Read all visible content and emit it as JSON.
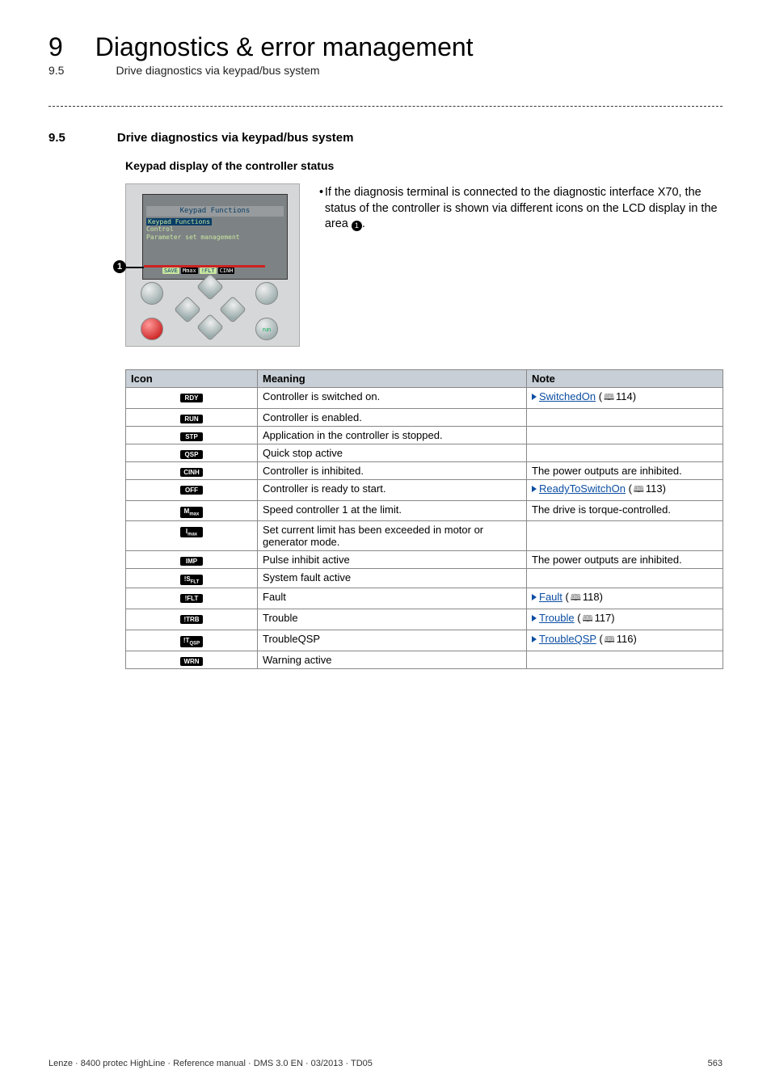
{
  "header": {
    "chapter_num": "9",
    "chapter_title": "Diagnostics & error management",
    "sub_num": "9.5",
    "sub_title": "Drive diagnostics via keypad/bus system"
  },
  "section": {
    "num": "9.5",
    "title": "Drive diagnostics via keypad/bus system",
    "keypad_heading": "Keypad display of the controller status"
  },
  "lcd": {
    "title": "Keypad Functions",
    "line1": "Keypad Functions",
    "line2": "Control",
    "line3": "Parameter set management",
    "s1": "SAVE",
    "s2": "Mmax",
    "s3": "!FLT",
    "s4": "CINH"
  },
  "callout_num": "1",
  "run_label": "run",
  "bullet": {
    "text_a": "If the diagnosis terminal is connected to the diagnostic interface X70, the status of the controller is shown via different icons on the LCD display in the area ",
    "text_b": "."
  },
  "table": {
    "h1": "Icon",
    "h2": "Meaning",
    "h3": "Note",
    "rows": [
      {
        "icon": "RDY",
        "meaning": "Controller is switched on.",
        "link": "SwitchedOn",
        "page": "114"
      },
      {
        "icon": "RUN",
        "meaning": "Controller is enabled.",
        "note": ""
      },
      {
        "icon": "STP",
        "meaning": "Application in the controller is stopped.",
        "note": ""
      },
      {
        "icon": "QSP",
        "meaning": "Quick stop active",
        "note": ""
      },
      {
        "icon": "CINH",
        "meaning": "Controller is inhibited.",
        "note": "The power outputs are inhibited."
      },
      {
        "icon": "OFF",
        "meaning": "Controller is ready to start.",
        "link": "ReadyToSwitchOn",
        "page": "113"
      },
      {
        "icon": "Mmax",
        "meaning": "Speed controller 1 at the limit.",
        "note": "The drive is torque-controlled."
      },
      {
        "icon": "Imax",
        "meaning": "Set current limit has been exceeded in motor or generator mode.",
        "note": ""
      },
      {
        "icon": "IMP",
        "meaning": "Pulse inhibit active",
        "note": "The power outputs are inhibited."
      },
      {
        "icon": "!SFLT",
        "meaning": "System fault active",
        "note": ""
      },
      {
        "icon": "!FLT",
        "meaning": "Fault",
        "link": "Fault",
        "page": "118"
      },
      {
        "icon": "!TRB",
        "meaning": "Trouble",
        "link": "Trouble",
        "page": "117"
      },
      {
        "icon": "!TQSP",
        "meaning": "TroubleQSP",
        "link": "TroubleQSP",
        "page": "116"
      },
      {
        "icon": "WRN",
        "meaning": "Warning active",
        "note": ""
      }
    ]
  },
  "footer": {
    "left": "Lenze · 8400 protec HighLine · Reference manual · DMS 3.0 EN · 03/2013 · TD05",
    "right": "563"
  }
}
